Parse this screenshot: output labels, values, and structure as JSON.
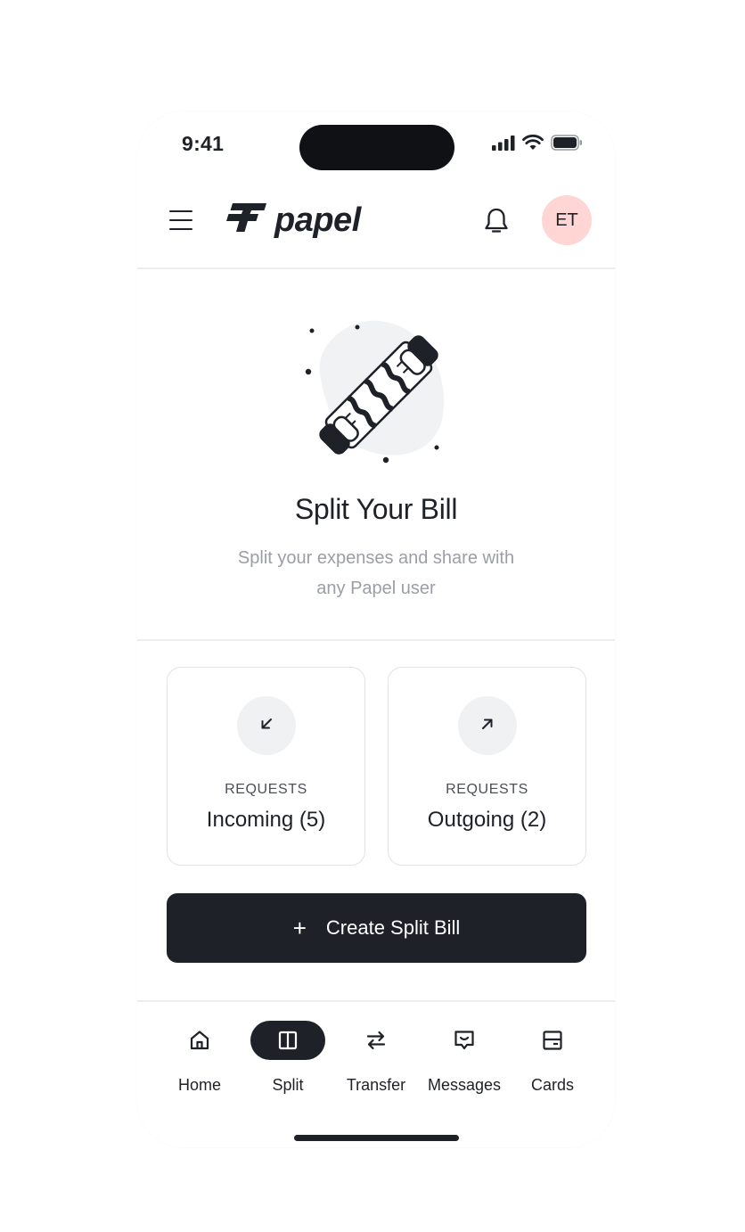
{
  "status_bar": {
    "time": "9:41"
  },
  "header": {
    "logo_text": "papel",
    "avatar_initials": "ET"
  },
  "hero": {
    "title": "Split Your Bill",
    "subtitle": "Split your expenses and share with any Papel user"
  },
  "requests": [
    {
      "label": "REQUESTS",
      "value": "Incoming (5)",
      "icon": "arrow-down-left-icon"
    },
    {
      "label": "REQUESTS",
      "value": "Outgoing (2)",
      "icon": "arrow-up-right-icon"
    }
  ],
  "create_button": {
    "label": "Create Split Bill"
  },
  "nav": {
    "items": [
      {
        "label": "Home",
        "icon": "home-icon"
      },
      {
        "label": "Split",
        "icon": "split-icon",
        "active": true
      },
      {
        "label": "Transfer",
        "icon": "transfer-icon"
      },
      {
        "label": "Messages",
        "icon": "messages-icon"
      },
      {
        "label": "Cards",
        "icon": "cards-icon"
      }
    ]
  },
  "colors": {
    "primary": "#1f2129",
    "avatar_bg": "#ffd6d3",
    "muted_text": "#9b9ea6",
    "icon_circle_bg": "#f0f1f3"
  }
}
